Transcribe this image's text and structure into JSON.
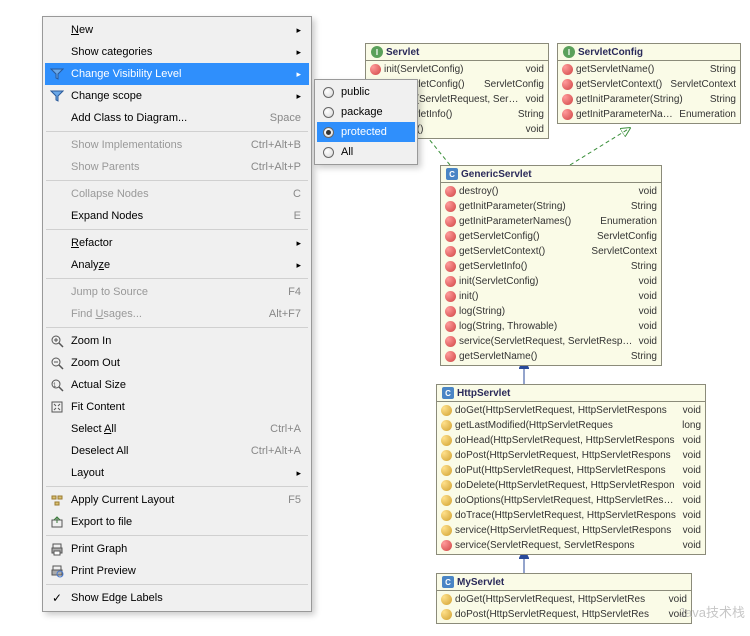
{
  "menu": {
    "new": "New",
    "show_cat": "Show categories",
    "chg_vis": "Change Visibility Level",
    "chg_scope": "Change scope",
    "add_class": "Add Class to Diagram...",
    "add_class_key": "Space",
    "show_impl": "Show Implementations",
    "show_impl_key": "Ctrl+Alt+B",
    "show_par": "Show Parents",
    "show_par_key": "Ctrl+Alt+P",
    "collapse": "Collapse Nodes",
    "collapse_key": "C",
    "expand": "Expand Nodes",
    "expand_key": "E",
    "refactor": "Refactor",
    "analyze": "Analyze",
    "jump": "Jump to Source",
    "jump_key": "F4",
    "find_u": "Find Usages...",
    "find_u_key": "Alt+F7",
    "zoom_in": "Zoom In",
    "zoom_out": "Zoom Out",
    "actual": "Actual Size",
    "fit": "Fit Content",
    "sel_all": "Select All",
    "sel_all_key": "Ctrl+A",
    "desel": "Deselect All",
    "desel_key": "Ctrl+Alt+A",
    "layout": "Layout",
    "apply_layout": "Apply Current Layout",
    "apply_layout_key": "F5",
    "export": "Export to file",
    "print_g": "Print Graph",
    "print_p": "Print Preview",
    "edge_lbl": "Show Edge Labels"
  },
  "submenu": {
    "public": "public",
    "package": "package",
    "protected": "protected",
    "all": "All"
  },
  "classes": {
    "servlet": {
      "name": "Servlet",
      "members": [
        {
          "icon": "red",
          "sig": "init(ServletConfig)",
          "type": "void"
        },
        {
          "icon": "red",
          "sig": "getServletConfig()",
          "type": "ServletConfig"
        },
        {
          "icon": "red",
          "sig": "service(ServletRequest, ServletRespons",
          "type": "void"
        },
        {
          "icon": "red",
          "sig": "getServletInfo()",
          "type": "String"
        },
        {
          "icon": "red",
          "sig": "destroy()",
          "type": "void"
        }
      ]
    },
    "servletConfig": {
      "name": "ServletConfig",
      "members": [
        {
          "icon": "red",
          "sig": "getServletName()",
          "type": "String"
        },
        {
          "icon": "red",
          "sig": "getServletContext()",
          "type": "ServletContext"
        },
        {
          "icon": "red",
          "sig": "getInitParameter(String)",
          "type": "String"
        },
        {
          "icon": "red",
          "sig": "getInitParameterNames()",
          "type": "Enumeration"
        }
      ]
    },
    "genericServlet": {
      "name": "GenericServlet",
      "members": [
        {
          "icon": "red",
          "sig": "destroy()",
          "type": "void"
        },
        {
          "icon": "red",
          "sig": "getInitParameter(String)",
          "type": "String"
        },
        {
          "icon": "red",
          "sig": "getInitParameterNames()",
          "type": "Enumeration"
        },
        {
          "icon": "red",
          "sig": "getServletConfig()",
          "type": "ServletConfig"
        },
        {
          "icon": "red",
          "sig": "getServletContext()",
          "type": "ServletContext"
        },
        {
          "icon": "red",
          "sig": "getServletInfo()",
          "type": "String"
        },
        {
          "icon": "red",
          "sig": "init(ServletConfig)",
          "type": "void"
        },
        {
          "icon": "red",
          "sig": "init()",
          "type": "void"
        },
        {
          "icon": "red",
          "sig": "log(String)",
          "type": "void"
        },
        {
          "icon": "red",
          "sig": "log(String, Throwable)",
          "type": "void"
        },
        {
          "icon": "red",
          "sig": "service(ServletRequest, ServletRespons",
          "type": "void"
        },
        {
          "icon": "red",
          "sig": "getServletName()",
          "type": "String"
        }
      ]
    },
    "httpServlet": {
      "name": "HttpServlet",
      "members": [
        {
          "icon": "yellow",
          "sig": "doGet(HttpServletRequest, HttpServletRespons",
          "type": "void"
        },
        {
          "icon": "yellow",
          "sig": "getLastModified(HttpServletReques",
          "type": "long"
        },
        {
          "icon": "yellow",
          "sig": "doHead(HttpServletRequest, HttpServletRespons",
          "type": "void"
        },
        {
          "icon": "yellow",
          "sig": "doPost(HttpServletRequest, HttpServletRespons",
          "type": "void"
        },
        {
          "icon": "yellow",
          "sig": "doPut(HttpServletRequest, HttpServletRespons",
          "type": "void"
        },
        {
          "icon": "yellow",
          "sig": "doDelete(HttpServletRequest, HttpServletRespon",
          "type": "void"
        },
        {
          "icon": "yellow",
          "sig": "doOptions(HttpServletRequest, HttpServletRespon",
          "type": "void"
        },
        {
          "icon": "yellow",
          "sig": "doTrace(HttpServletRequest, HttpServletRespons",
          "type": "void"
        },
        {
          "icon": "yellow",
          "sig": "service(HttpServletRequest, HttpServletRespons",
          "type": "void"
        },
        {
          "icon": "red",
          "sig": "service(ServletRequest, ServletRespons",
          "type": "void"
        }
      ]
    },
    "myServlet": {
      "name": "MyServlet",
      "members": [
        {
          "icon": "yellow",
          "sig": "doGet(HttpServletRequest, HttpServletRes",
          "type": "void"
        },
        {
          "icon": "yellow",
          "sig": "doPost(HttpServletRequest, HttpServletRes",
          "type": "void"
        }
      ]
    }
  },
  "watermark": "Java技术栈"
}
